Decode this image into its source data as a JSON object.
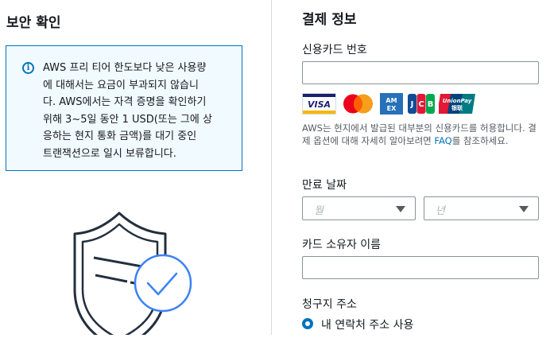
{
  "security": {
    "title": "보안 확인",
    "info_lines": [
      "AWS 프리 티어 한도보다 낮은 사용량",
      "에 대해서는 요금이 부과되지 않습니",
      "다. AWS에서는 자격 증명을 확인하기",
      "위해 3~5일 동안 1 USD(또는 그에 상",
      "응하는 현지 통화 금액)를 대기 중인",
      "트랜잭션으로 일시 보류합니다."
    ]
  },
  "payment": {
    "title": "결제 정보",
    "card_number_label": "신용카드 번호",
    "card_number_value": "",
    "card_brands": [
      {
        "name": "VISA",
        "text": "VISA"
      },
      {
        "name": "Mastercard",
        "text": ""
      },
      {
        "name": "American Express",
        "text": "AM EX"
      },
      {
        "name": "JCB",
        "text": "JCB"
      },
      {
        "name": "UnionPay",
        "text": "UnionPay 银联"
      }
    ],
    "help_text_before": "AWS는 현지에서 발급된 대부분의 신용카드를 허용합니다. 결제 옵션에 대해 자세히 알아보려면 ",
    "help_link": "FAQ",
    "help_text_after": "를 참조하세요.",
    "expiry_label": "만료 날짜",
    "month_placeholder": "월",
    "year_placeholder": "년",
    "cardholder_label": "카드 소유자 이름",
    "cardholder_value": "",
    "billing_address_label": "청구지 주소",
    "billing_option": "내 연락처 주소 사용",
    "billing_option_selected": true
  },
  "colors": {
    "accent": "#0073bb",
    "info_bg": "#f1faff",
    "text": "#16191f",
    "muted": "#545b64",
    "border": "#879596",
    "shield": "#232f3e",
    "check": "#3b82f6"
  },
  "icons": [
    "info-icon",
    "shield-check-icon",
    "caret-down-icon",
    "radio-selected-icon"
  ]
}
